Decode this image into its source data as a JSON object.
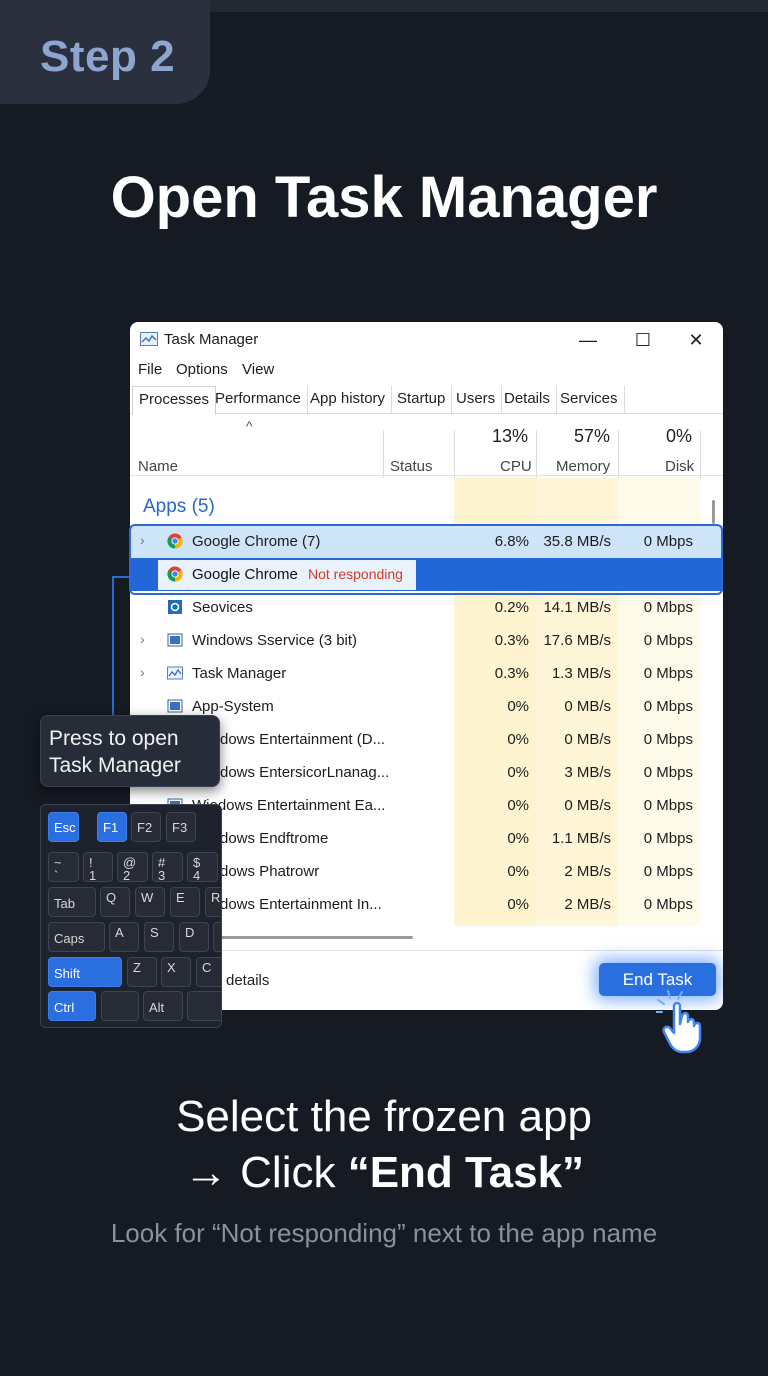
{
  "step": {
    "label": "Step 2"
  },
  "title": "Open Task Manager",
  "window": {
    "title": "Task Manager",
    "controls": {
      "minimize": "—",
      "maximize": "☐",
      "close": "✕"
    },
    "menu": [
      "File",
      "Options",
      "View"
    ],
    "tabs": [
      "Processes",
      "Performance",
      "App history",
      "Startup",
      "Users",
      "Details",
      "Services"
    ],
    "active_tab": "Processes",
    "headers": {
      "name": "Name",
      "status": "Status",
      "cpu_pct": "13%",
      "cpu": "CPU",
      "mem_pct": "57%",
      "mem": "Memory",
      "disk_pct": "0%",
      "disk": "Disk"
    },
    "group": "Apps (5)",
    "rows": [
      {
        "name": "Google Chrome (7)",
        "status": "",
        "cpu": "6.8%",
        "mem": "35.8 MB/s",
        "disk": "0 Mbps",
        "expand": "›",
        "icon": "chrome-icon"
      },
      {
        "name": "Google Chrome",
        "status": "Not responding",
        "cpu": "",
        "mem": "",
        "disk": "",
        "expand": "",
        "icon": "chrome-icon"
      },
      {
        "name": "Seovices",
        "status": "",
        "cpu": "0.2%",
        "mem": "14.1 MB/s",
        "disk": "0 Mbps",
        "expand": "",
        "icon": "services-icon"
      },
      {
        "name": "Windows Sservice (3 bit)",
        "status": "",
        "cpu": "0.3%",
        "mem": "17.6 MB/s",
        "disk": "0 Mbps",
        "expand": "›",
        "icon": "window-icon"
      },
      {
        "name": "Task Manager",
        "status": "",
        "cpu": "0.3%",
        "mem": "1.3 MB/s",
        "disk": "0 Mbps",
        "expand": "›",
        "icon": "taskmgr-icon"
      },
      {
        "name": "App-System",
        "status": "",
        "cpu": "0%",
        "mem": "0 MB/s",
        "disk": "0 Mbps",
        "expand": "",
        "icon": "window-icon"
      },
      {
        "name": "dows Entertainment (D...",
        "status": "",
        "cpu": "0%",
        "mem": "0 MB/s",
        "disk": "0 Mbps",
        "expand": "",
        "icon": ""
      },
      {
        "name": "dows EntersicorLnanag...",
        "status": "",
        "cpu": "0%",
        "mem": "3 MB/s",
        "disk": "0 Mbps",
        "expand": "",
        "icon": ""
      },
      {
        "name": "Wiodows Entertainment Ea...",
        "status": "",
        "cpu": "0%",
        "mem": "0 MB/s",
        "disk": "0 Mbps",
        "expand": "",
        "icon": ""
      },
      {
        "name": "dows Endftrome",
        "status": "",
        "cpu": "0%",
        "mem": "1.1 MB/s",
        "disk": "0 Mbps",
        "expand": "",
        "icon": ""
      },
      {
        "name": "dows Phatrowr",
        "status": "",
        "cpu": "0%",
        "mem": "2 MB/s",
        "disk": "0 Mbps",
        "expand": "",
        "icon": ""
      },
      {
        "name": "dows Entertainment In...",
        "status": "",
        "cpu": "0%",
        "mem": "2 MB/s",
        "disk": "0 Mbps",
        "expand": "",
        "icon": ""
      }
    ],
    "details_link": "details",
    "end_task": "End Task"
  },
  "tooltip": {
    "line1": "Press to open",
    "line2": "Task Manager"
  },
  "keyboard": {
    "row1": [
      "Esc",
      "F1",
      "F2",
      "F3"
    ],
    "row2": [
      [
        "~",
        "`"
      ],
      [
        "!",
        "1"
      ],
      [
        "@",
        "2"
      ],
      [
        "#",
        "3"
      ],
      [
        "$",
        "4"
      ]
    ],
    "row3": [
      "Tab",
      "Q",
      "W",
      "E",
      "R"
    ],
    "row4": [
      "Caps",
      "A",
      "S",
      "D",
      ""
    ],
    "row5": [
      "Shift",
      "Z",
      "X",
      "C"
    ],
    "row6": [
      "Ctrl",
      "",
      "Alt",
      ""
    ]
  },
  "caption": {
    "line1": "Select the frozen app",
    "line2_prefix": "→ Click ",
    "line2_bold": "“End Task”",
    "hint": "Look for “Not responding” next to the app name"
  },
  "colors": {
    "accent": "#2a6fe0",
    "background": "#161a23",
    "not_responding": "#d33b2a",
    "group": "#2b67c6"
  }
}
